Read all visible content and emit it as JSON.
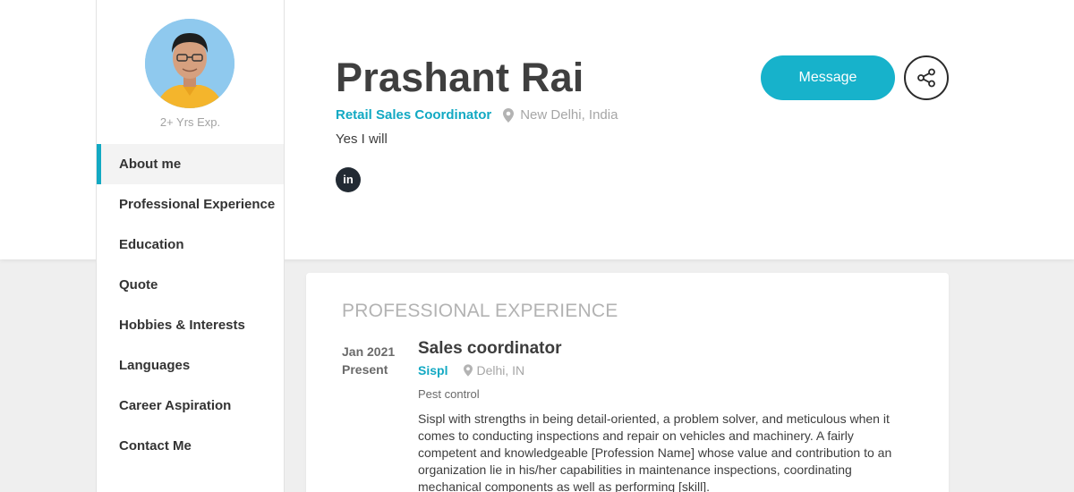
{
  "profile": {
    "name": "Prashant Rai",
    "title": "Retail Sales Coordinator",
    "location": "New Delhi, India",
    "tagline": "Yes I will",
    "experience_years": "2+ Yrs Exp.",
    "linkedin_label": "in"
  },
  "actions": {
    "message_label": "Message",
    "share_icon": "share-icon"
  },
  "sidebar": {
    "active_index": 0,
    "items": [
      {
        "label": "About me"
      },
      {
        "label": "Professional Experience"
      },
      {
        "label": "Education"
      },
      {
        "label": "Quote"
      },
      {
        "label": "Hobbies & Interests"
      },
      {
        "label": "Languages"
      },
      {
        "label": "Career Aspiration"
      },
      {
        "label": "Contact Me"
      }
    ]
  },
  "experience_section": {
    "title": "PROFESSIONAL EXPERIENCE",
    "items": [
      {
        "start": "Jan 2021",
        "end": "Present",
        "role": "Sales coordinator",
        "company": "Sispl",
        "location": "Delhi, IN",
        "industry": "Pest control",
        "description": "Sispl with strengths in being detail-oriented, a problem solver, and meticulous when it comes to conducting inspections and repair on vehicles and machinery. A fairly competent and knowledgeable [Profession Name] whose value and contribution to an organization lie in his/her capabilities in maintenance inspections, coordinating mechanical components as well as performing [skill]."
      }
    ]
  },
  "colors": {
    "accent": "#12a9c3",
    "button": "#17b2cb",
    "background": "#efefef",
    "dark": "#222a33"
  }
}
